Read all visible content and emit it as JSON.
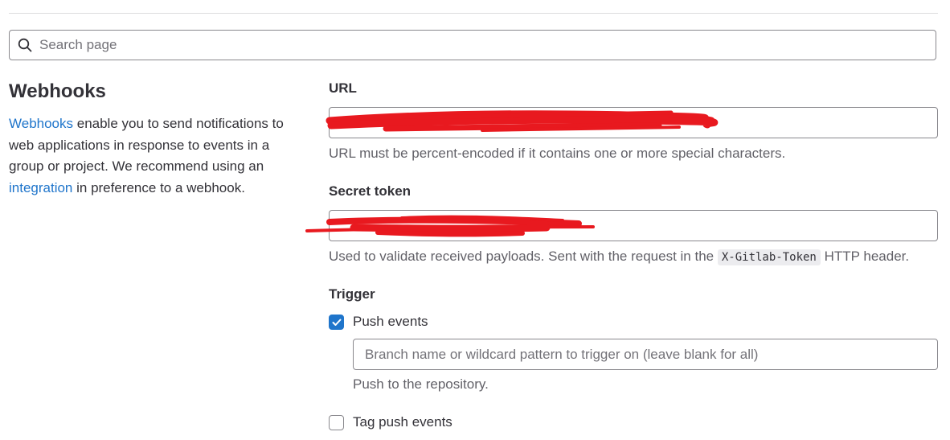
{
  "search": {
    "placeholder": "Search page"
  },
  "webhooks": {
    "title": "Webhooks",
    "desc_link1": "Webhooks",
    "desc_part1": " enable you to send notifications to web applications in response to events in a group or project. We recommend using an ",
    "desc_link2": "integration",
    "desc_part2": " in preference to a webhook."
  },
  "url_field": {
    "label": "URL",
    "value": "",
    "help": "URL must be percent-encoded if it contains one or more special characters."
  },
  "secret_field": {
    "label": "Secret token",
    "value": "",
    "help_prefix": "Used to validate received payloads. Sent with the request in the ",
    "help_code": "X-Gitlab-Token",
    "help_suffix": " HTTP header."
  },
  "trigger": {
    "label": "Trigger",
    "push_events": {
      "label": "Push events",
      "checked": true,
      "branch_placeholder": "Branch name or wildcard pattern to trigger on (leave blank for all)",
      "help": "Push to the repository."
    },
    "tag_push_events": {
      "label": "Tag push events",
      "checked": false
    }
  },
  "colors": {
    "link": "#1f75cb",
    "checkbox_checked": "#1f75cb",
    "redaction": "#e8191f"
  }
}
